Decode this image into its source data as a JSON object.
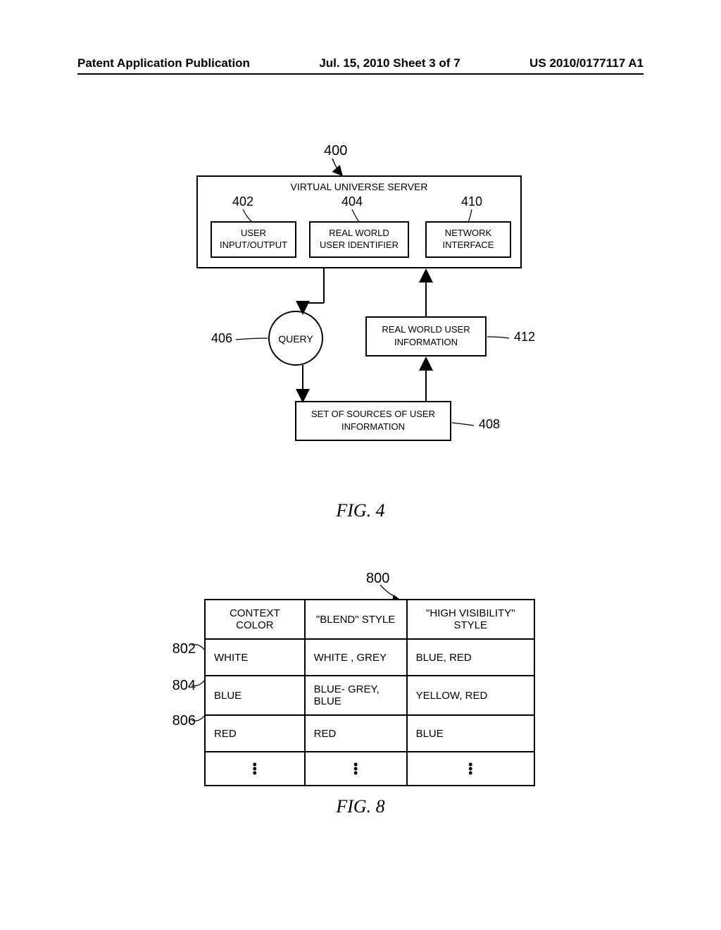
{
  "header": {
    "left": "Patent Application Publication",
    "center": "Jul. 15, 2010  Sheet 3 of 7",
    "right": "US 2010/0177117 A1"
  },
  "fig4": {
    "ref_top": "400",
    "server_title": "VIRTUAL UNIVERSE SERVER",
    "box_user_io": {
      "ref": "402",
      "label1": "USER",
      "label2": "INPUT/OUTPUT"
    },
    "box_rw_id": {
      "ref": "404",
      "label1": "REAL WORLD",
      "label2": "USER IDENTIFIER"
    },
    "box_network": {
      "ref": "410",
      "label1": "NETWORK",
      "label2": "INTERFACE"
    },
    "query": {
      "ref": "406",
      "label": "QUERY"
    },
    "rw_info": {
      "ref": "412",
      "label1": "REAL WORLD USER",
      "label2": "INFORMATION"
    },
    "sources": {
      "ref": "408",
      "label1": "SET OF SOURCES OF USER",
      "label2": "INFORMATION"
    },
    "caption": "FIG. 4"
  },
  "fig8": {
    "ref_top": "800",
    "headers": [
      "CONTEXT COLOR",
      "\"BLEND\" STYLE",
      "\"HIGH VISIBILITY\" STYLE"
    ],
    "rows": [
      {
        "ref": "802",
        "cells": [
          "WHITE",
          "WHITE , GREY",
          "BLUE, RED"
        ]
      },
      {
        "ref": "804",
        "cells": [
          "BLUE",
          "BLUE- GREY, BLUE",
          "YELLOW, RED"
        ]
      },
      {
        "ref": "806",
        "cells": [
          "RED",
          "RED",
          "BLUE"
        ]
      }
    ],
    "caption": "FIG. 8"
  },
  "chart_data": {
    "type": "table",
    "title": "Color style mapping (FIG. 8)",
    "columns": [
      "CONTEXT COLOR",
      "\"BLEND\" STYLE",
      "\"HIGH VISIBILITY\" STYLE"
    ],
    "rows": [
      [
        "WHITE",
        "WHITE , GREY",
        "BLUE, RED"
      ],
      [
        "BLUE",
        "BLUE- GREY, BLUE",
        "YELLOW, RED"
      ],
      [
        "RED",
        "RED",
        "BLUE"
      ]
    ]
  }
}
